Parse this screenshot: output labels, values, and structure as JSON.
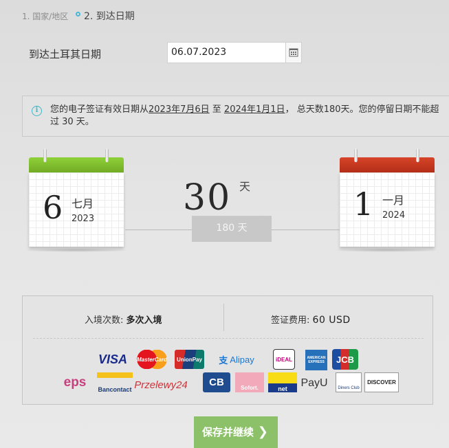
{
  "breadcrumb": {
    "step1": "1. 国家/地区",
    "step2": "2. 到达日期"
  },
  "arrival": {
    "label": "到达土耳其日期",
    "value": "06.07.2023"
  },
  "info": {
    "text_a": "您的电子签证有效日期从",
    "valid_from": "2023年7月6日",
    "text_b": " 至 ",
    "valid_to": "2024年1月1日",
    "text_c": "， 总天数180天。您的停留日期不能超过 30 天。"
  },
  "start_cal": {
    "day": "6",
    "month": "七月",
    "year": "2023",
    "color": "#7dbb2d"
  },
  "end_cal": {
    "day": "1",
    "month": "一月",
    "year": "2024",
    "color": "#c9361d"
  },
  "stay": {
    "days": "30",
    "unit": "天",
    "total": "180 天"
  },
  "summary": {
    "entries_label": "入境次数:",
    "entries_value": "多次入境",
    "fee_label": "签证费用:",
    "fee_value": "60 USD"
  },
  "payment_logos": {
    "row1": [
      "VISA",
      "MasterCard",
      "UnionPay",
      "Alipay",
      "iDEAL",
      "AMERICAN EXPRESS",
      "JCB"
    ],
    "row2": [
      "eps",
      "Bancontact",
      "Przelewy24",
      "CB",
      "Sofort.",
      "net",
      "PayU",
      "Diners Club",
      "DISCOVER"
    ]
  },
  "continue_button": {
    "label": "保存并继续"
  }
}
